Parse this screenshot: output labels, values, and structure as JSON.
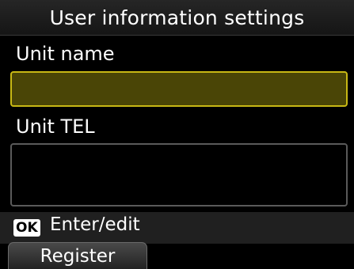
{
  "screen": {
    "title": "User information settings"
  },
  "fields": {
    "unit_name": {
      "label": "Unit name",
      "value": ""
    },
    "unit_tel": {
      "label": "Unit TEL",
      "value": ""
    }
  },
  "hint": {
    "key_label": "OK",
    "text": "Enter/edit"
  },
  "buttons": {
    "register_label": "Register"
  },
  "colors": {
    "selected_field_fill": "#4a4506",
    "selected_field_border": "#c8b814"
  }
}
